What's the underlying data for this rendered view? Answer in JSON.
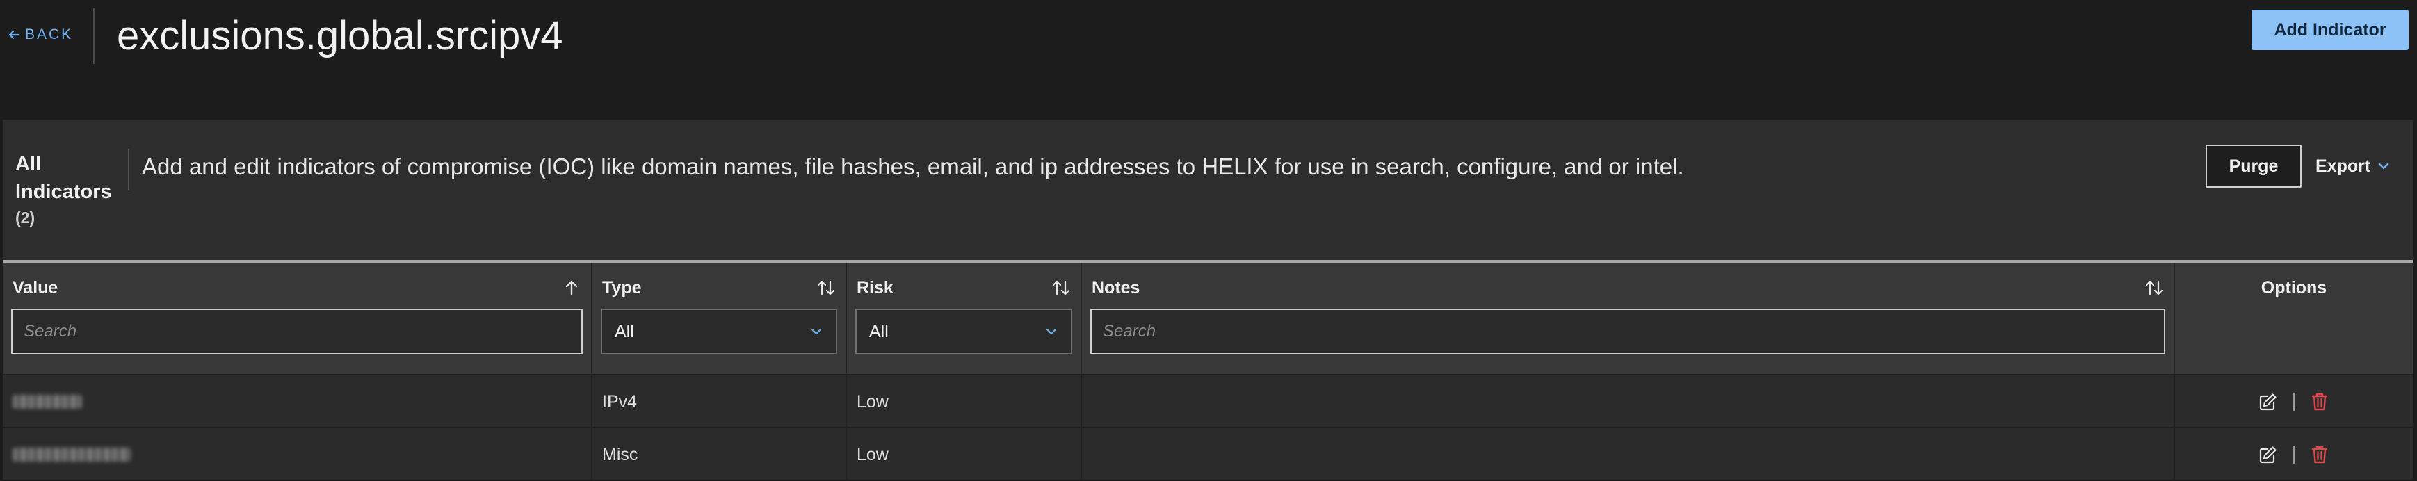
{
  "header": {
    "back_label": "BACK",
    "title": "exclusions.global.srcipv4",
    "add_button": "Add Indicator"
  },
  "summary": {
    "heading": "All Indicators",
    "count": "(2)",
    "description": "Add and edit indicators of compromise (IOC) like domain names, file hashes, email, and ip addresses to HELIX for use in search, configure, and or intel.",
    "purge_button": "Purge",
    "export_button": "Export"
  },
  "table": {
    "columns": {
      "value": "Value",
      "type": "Type",
      "risk": "Risk",
      "notes": "Notes",
      "options": "Options"
    },
    "filters": {
      "value_placeholder": "Search",
      "type_selected": "All",
      "risk_selected": "All",
      "notes_placeholder": "Search"
    },
    "rows": [
      {
        "value": "",
        "type": "IPv4",
        "risk": "Low",
        "notes": ""
      },
      {
        "value": "",
        "type": "Misc",
        "risk": "Low",
        "notes": ""
      }
    ]
  },
  "colors": {
    "accent": "#8cc2f5",
    "link": "#6fb1f5",
    "delete": "#e0474c"
  },
  "icons": [
    "arrow-left-icon",
    "chevron-down-icon",
    "sort-up-icon",
    "sort-both-icon",
    "edit-icon",
    "trash-icon"
  ]
}
